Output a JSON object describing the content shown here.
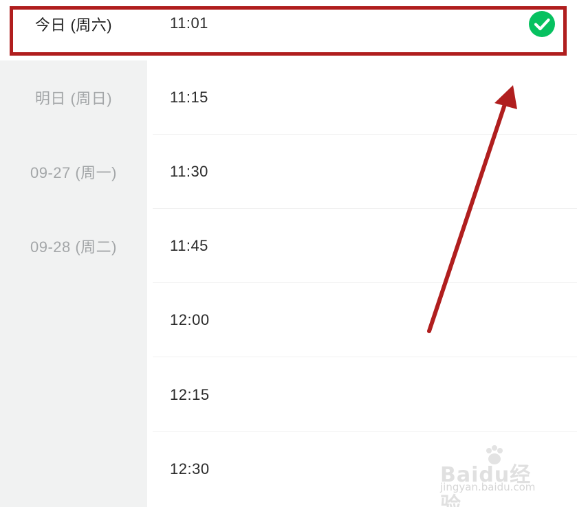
{
  "dates": {
    "today": "今日 (周六)",
    "items": [
      "明日 (周日)",
      "09-27 (周一)",
      "09-28 (周二)"
    ]
  },
  "times": [
    "11:01",
    "11:15",
    "11:30",
    "11:45",
    "12:00",
    "12:15",
    "12:30"
  ],
  "icons": {
    "selected": "check-circle-icon"
  },
  "colors": {
    "accent_green": "#07c160",
    "highlight_red": "#b01e1e",
    "sidebar_bg": "#f1f2f2",
    "muted_text": "#a3a6a8"
  },
  "watermark": {
    "brand": "Baidu经验",
    "url": "jingyan.baidu.com"
  }
}
